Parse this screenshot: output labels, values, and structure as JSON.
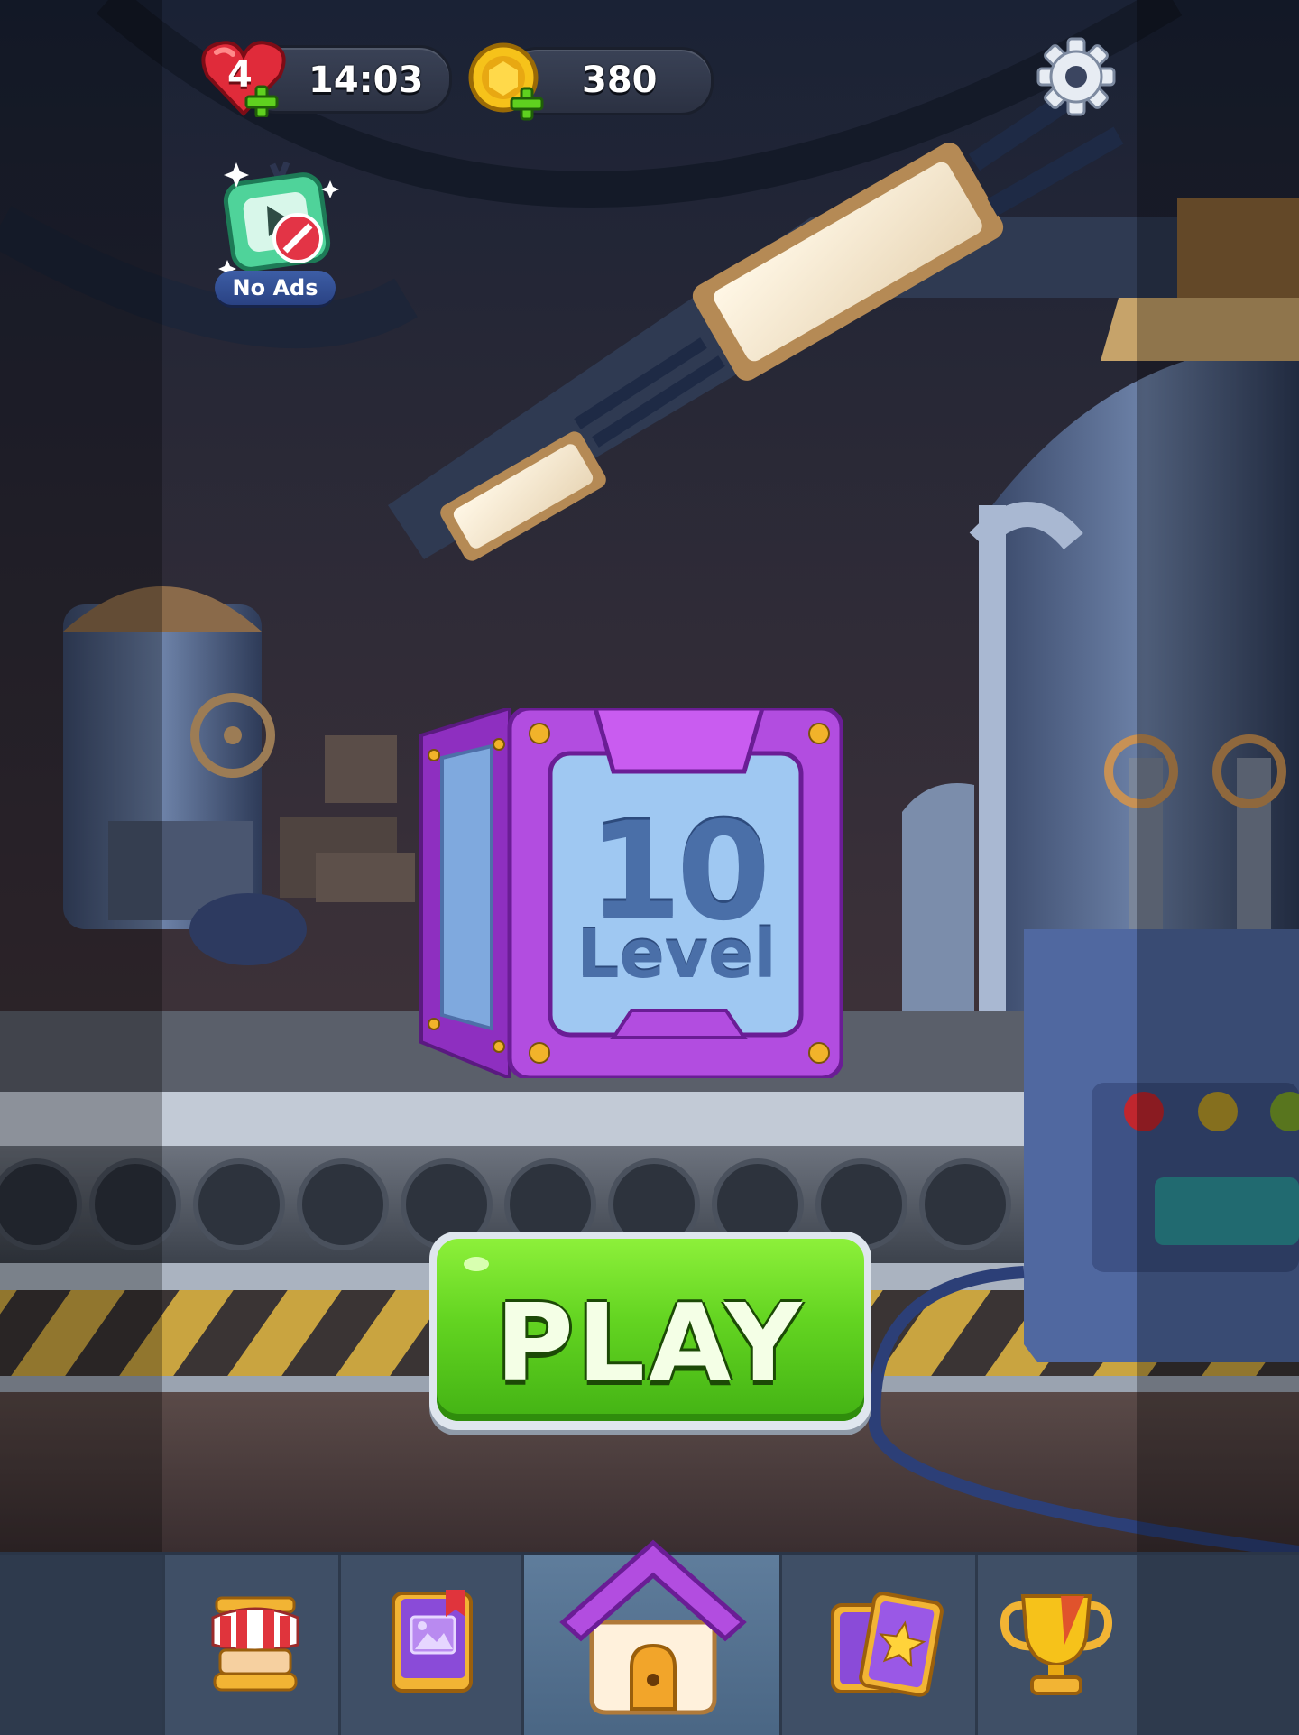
{
  "hud": {
    "lives": "4",
    "timer": "14:03",
    "coins": "380",
    "lives_icon": "heart-plus-icon",
    "coins_icon": "coin-plus-icon",
    "settings_icon": "gear-icon"
  },
  "promo": {
    "label": "No Ads",
    "icon": "tv-no-ads-icon"
  },
  "level": {
    "number": "10",
    "word": "Level"
  },
  "play": {
    "label": "PLAY"
  },
  "nav": {
    "tabs": [
      {
        "name": "shop",
        "icon": "shop-icon",
        "active": false
      },
      {
        "name": "album",
        "icon": "picture-book-icon",
        "active": false
      },
      {
        "name": "home",
        "icon": "house-icon",
        "active": true
      },
      {
        "name": "cards",
        "icon": "star-cards-icon",
        "active": false
      },
      {
        "name": "leaderboard",
        "icon": "trophy-icon",
        "active": false
      }
    ]
  },
  "colors": {
    "play_green": "#5fd11f",
    "level_purple": "#b24de0",
    "nav_bg": "#3f4f66"
  }
}
